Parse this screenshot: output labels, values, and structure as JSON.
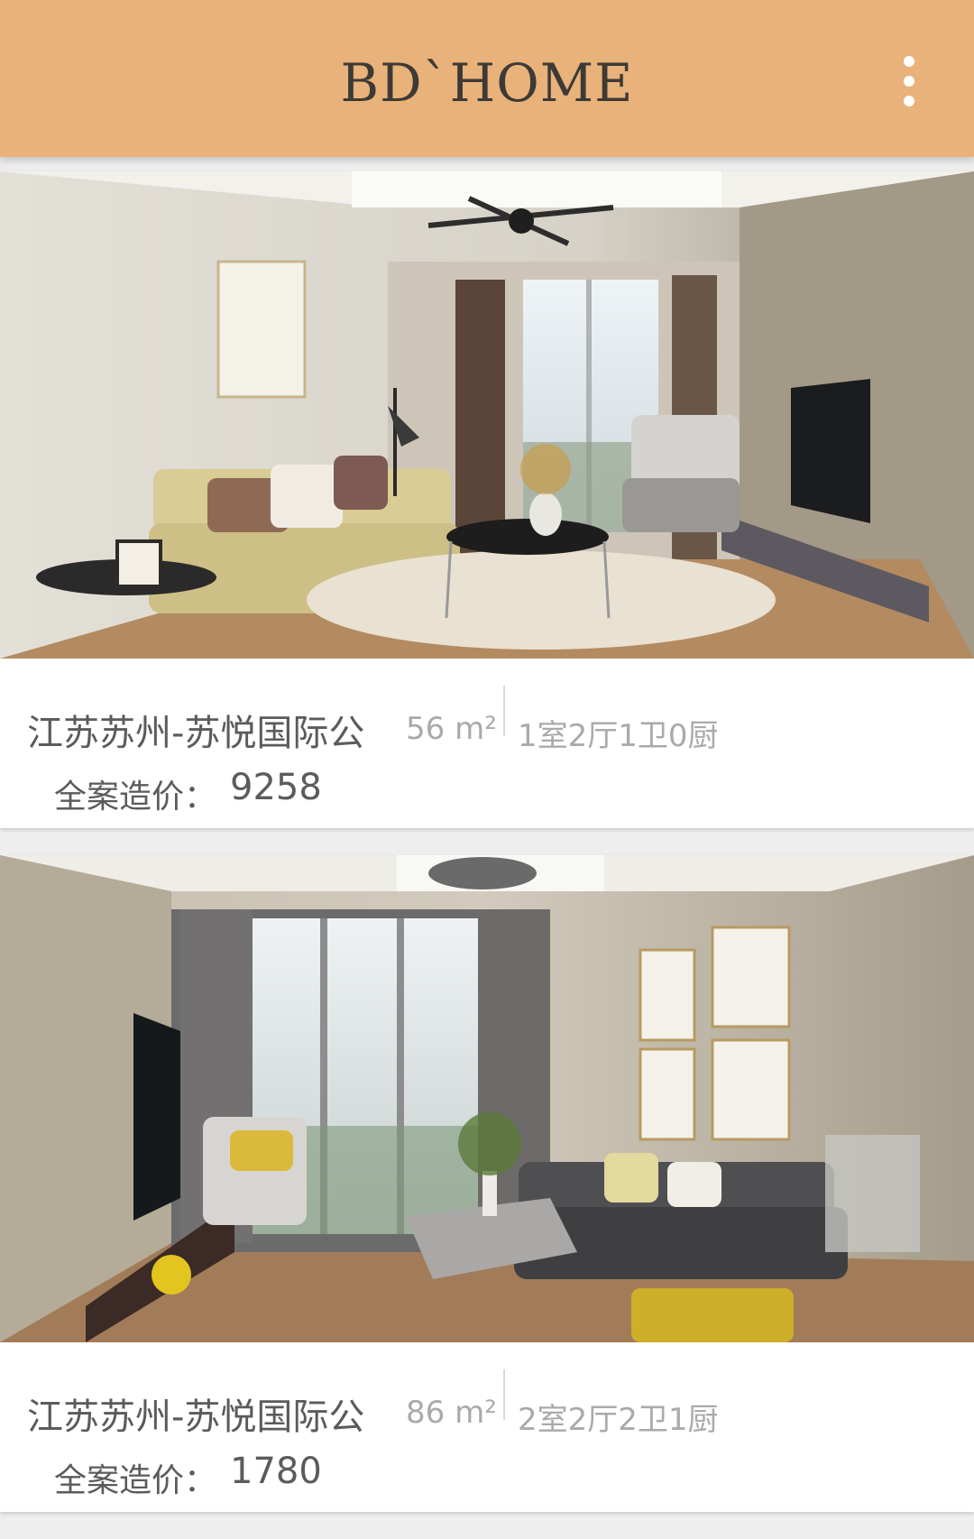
{
  "app_bar": {
    "title": "BD`HOME",
    "menu_icon": "more-vertical-icon",
    "background": "#e8b27a"
  },
  "listings": [
    {
      "image_icon": "living-room-photo",
      "title": "江苏苏州-苏悦国际公",
      "area": "56 m²",
      "layout": "1室2厅1卫0厨",
      "price_label": "全案造价：",
      "price": "9258"
    },
    {
      "image_icon": "living-room-photo",
      "title": "江苏苏州-苏悦国际公",
      "area": "86 m²",
      "layout": "2室2厅2卫1厨",
      "price_label": "全案造价：",
      "price": "1780"
    }
  ]
}
